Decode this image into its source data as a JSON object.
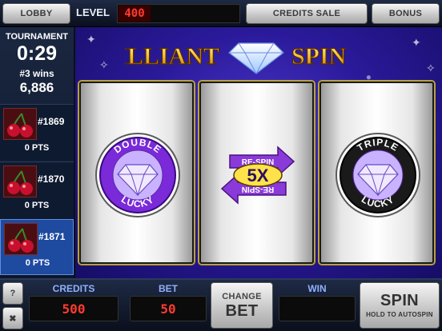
{
  "top": {
    "lobby_label": "LOBBY",
    "level_label": "LEVEL",
    "level_value": "400",
    "credits_sale_label": "CREDITS SALE",
    "bonus_label": "BONUS"
  },
  "tournament": {
    "title": "TOURNAMENT",
    "timer": "0:29",
    "wins": "#3 wins",
    "score": "6,886",
    "entries": [
      {
        "rank": "#1869",
        "points": "0 PTS"
      },
      {
        "rank": "#1870",
        "points": "0 PTS"
      },
      {
        "rank": "#1871",
        "points": "0 PTS"
      }
    ]
  },
  "game": {
    "logo_text_left": "BRILLIANT",
    "logo_text_right": "SPIN",
    "reels": [
      {
        "symbol_top": "DOUBLE",
        "symbol_bottom": "LUCKY",
        "icon": "diamond-icon"
      },
      {
        "symbol_top": "RE-SPIN",
        "symbol_middle": "5X",
        "symbol_bottom": "RE-SPIN",
        "icon": "respin-arrows-icon"
      },
      {
        "symbol_top": "TRIPLE",
        "symbol_bottom": "LUCKY",
        "icon": "diamond-icon"
      }
    ]
  },
  "bottom": {
    "credits_label": "CREDITS",
    "credits_value": "500",
    "bet_label": "BET",
    "bet_value": "50",
    "change_bet_line1": "CHANGE",
    "change_bet_line2": "BET",
    "win_label": "WIN",
    "win_value": "",
    "spin_label": "SPIN",
    "spin_sublabel": "HOLD TO AUTOSPIN",
    "help_label": "?"
  },
  "colors": {
    "accent_red": "#ff3b2f",
    "label_blue": "#8fb0ff",
    "background_purple": "#2a1a9a"
  }
}
